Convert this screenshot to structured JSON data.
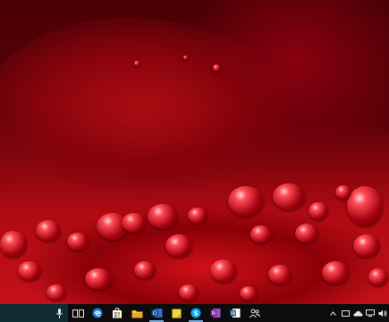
{
  "desktop": {
    "wallpaper": "red-rose-petals-with-water-drops"
  },
  "taskbar": {
    "search_box": {
      "icon": "microphone-icon"
    },
    "pinned": [
      {
        "name": "task-view-icon"
      },
      {
        "name": "edge-icon"
      },
      {
        "name": "store-icon"
      },
      {
        "name": "file-explorer-icon"
      },
      {
        "name": "outlook-icon"
      },
      {
        "name": "sticky-notes-icon"
      },
      {
        "name": "skype-icon"
      },
      {
        "name": "onenote-icon"
      },
      {
        "name": "word-icon"
      },
      {
        "name": "people-icon"
      }
    ],
    "tray": [
      {
        "name": "chevron-up-icon"
      },
      {
        "name": "screen-icon"
      },
      {
        "name": "onedrive-icon"
      },
      {
        "name": "network-icon"
      },
      {
        "name": "volume-icon"
      }
    ]
  },
  "colors": {
    "taskbar": "#0c0c0c",
    "search": "#0f2c33",
    "accent": "#7aa6d6"
  }
}
